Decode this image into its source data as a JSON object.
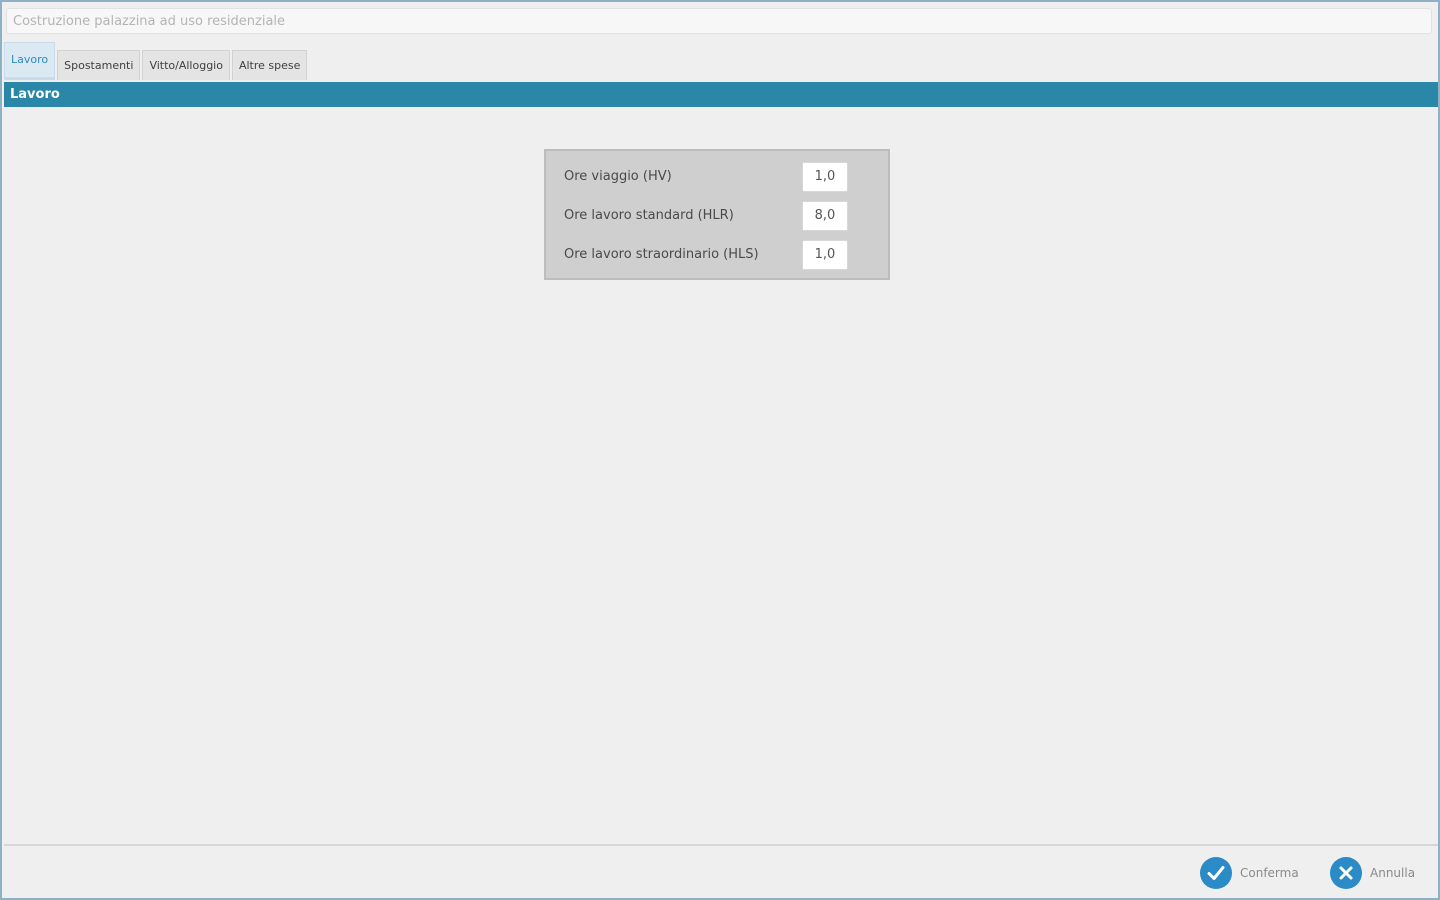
{
  "header": {
    "title_value": "Costruzione palazzina ad uso residenziale"
  },
  "tabs": [
    {
      "label": "Lavoro",
      "active": true
    },
    {
      "label": "Spostamenti",
      "active": false
    },
    {
      "label": "Vitto/Alloggio",
      "active": false
    },
    {
      "label": "Altre spese",
      "active": false
    }
  ],
  "section": {
    "title": "Lavoro"
  },
  "form": {
    "rows": [
      {
        "label": "Ore viaggio (HV)",
        "value": "1,0"
      },
      {
        "label": "Ore lavoro standard (HLR)",
        "value": "8,0"
      },
      {
        "label": "Ore lavoro straordinario (HLS)",
        "value": "1,0"
      }
    ]
  },
  "footer": {
    "confirm_label": "Conferma",
    "cancel_label": "Annulla",
    "confirm_icon": "check-icon",
    "cancel_icon": "close-icon"
  },
  "colors": {
    "accent": "#2a87a8",
    "tab_active_underline": "#e8506f",
    "icon_blue": "#2a8bc6"
  }
}
